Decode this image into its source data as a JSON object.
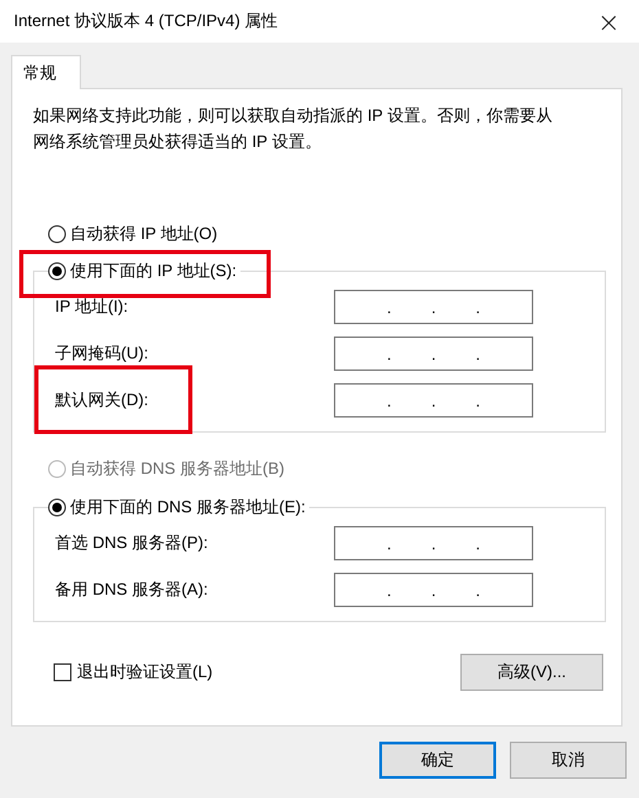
{
  "window": {
    "title": "Internet 协议版本 4 (TCP/IPv4) 属性",
    "close": "×"
  },
  "tabs": [
    {
      "label": "常规",
      "selected": true
    }
  ],
  "description": "如果网络支持此功能，则可以获取自动指派的 IP 设置。否则，你需要从网络系统管理员处获得适当的 IP 设置。",
  "ip_auto": {
    "label": "自动获得 IP 地址(O)",
    "selected": false,
    "disabled": false,
    "highlighted": false
  },
  "ip_manual": {
    "label": "使用下面的 IP 地址(S):",
    "selected": true,
    "disabled": false,
    "highlighted": true
  },
  "ip_fields": [
    {
      "label": "IP 地址(I):",
      "separators": [
        ".",
        ".",
        "."
      ],
      "highlighted": false
    },
    {
      "label": "子网掩码(U):",
      "separators": [
        ".",
        ".",
        "."
      ],
      "highlighted": false
    },
    {
      "label": "默认网关(D):",
      "separators": [
        ".",
        ".",
        "."
      ],
      "highlighted": true
    }
  ],
  "dns_auto": {
    "label": "自动获得 DNS 服务器地址(B)",
    "selected": false,
    "disabled": true,
    "highlighted": false
  },
  "dns_manual": {
    "label": "使用下面的 DNS 服务器地址(E):",
    "selected": true,
    "disabled": false,
    "highlighted": false
  },
  "dns_fields": [
    {
      "label": "首选 DNS 服务器(P):",
      "separators": [
        ".",
        ".",
        "."
      ],
      "highlighted": false
    },
    {
      "label": "备用 DNS 服务器(A):",
      "separators": [
        ".",
        ".",
        "."
      ],
      "highlighted": false
    }
  ],
  "validate": {
    "label": "退出时验证设置(L)",
    "checked": false
  },
  "advanced_button": "高级(V)...",
  "buttons": [
    {
      "label": "确定",
      "default": true
    },
    {
      "label": "取消",
      "default": false
    }
  ]
}
